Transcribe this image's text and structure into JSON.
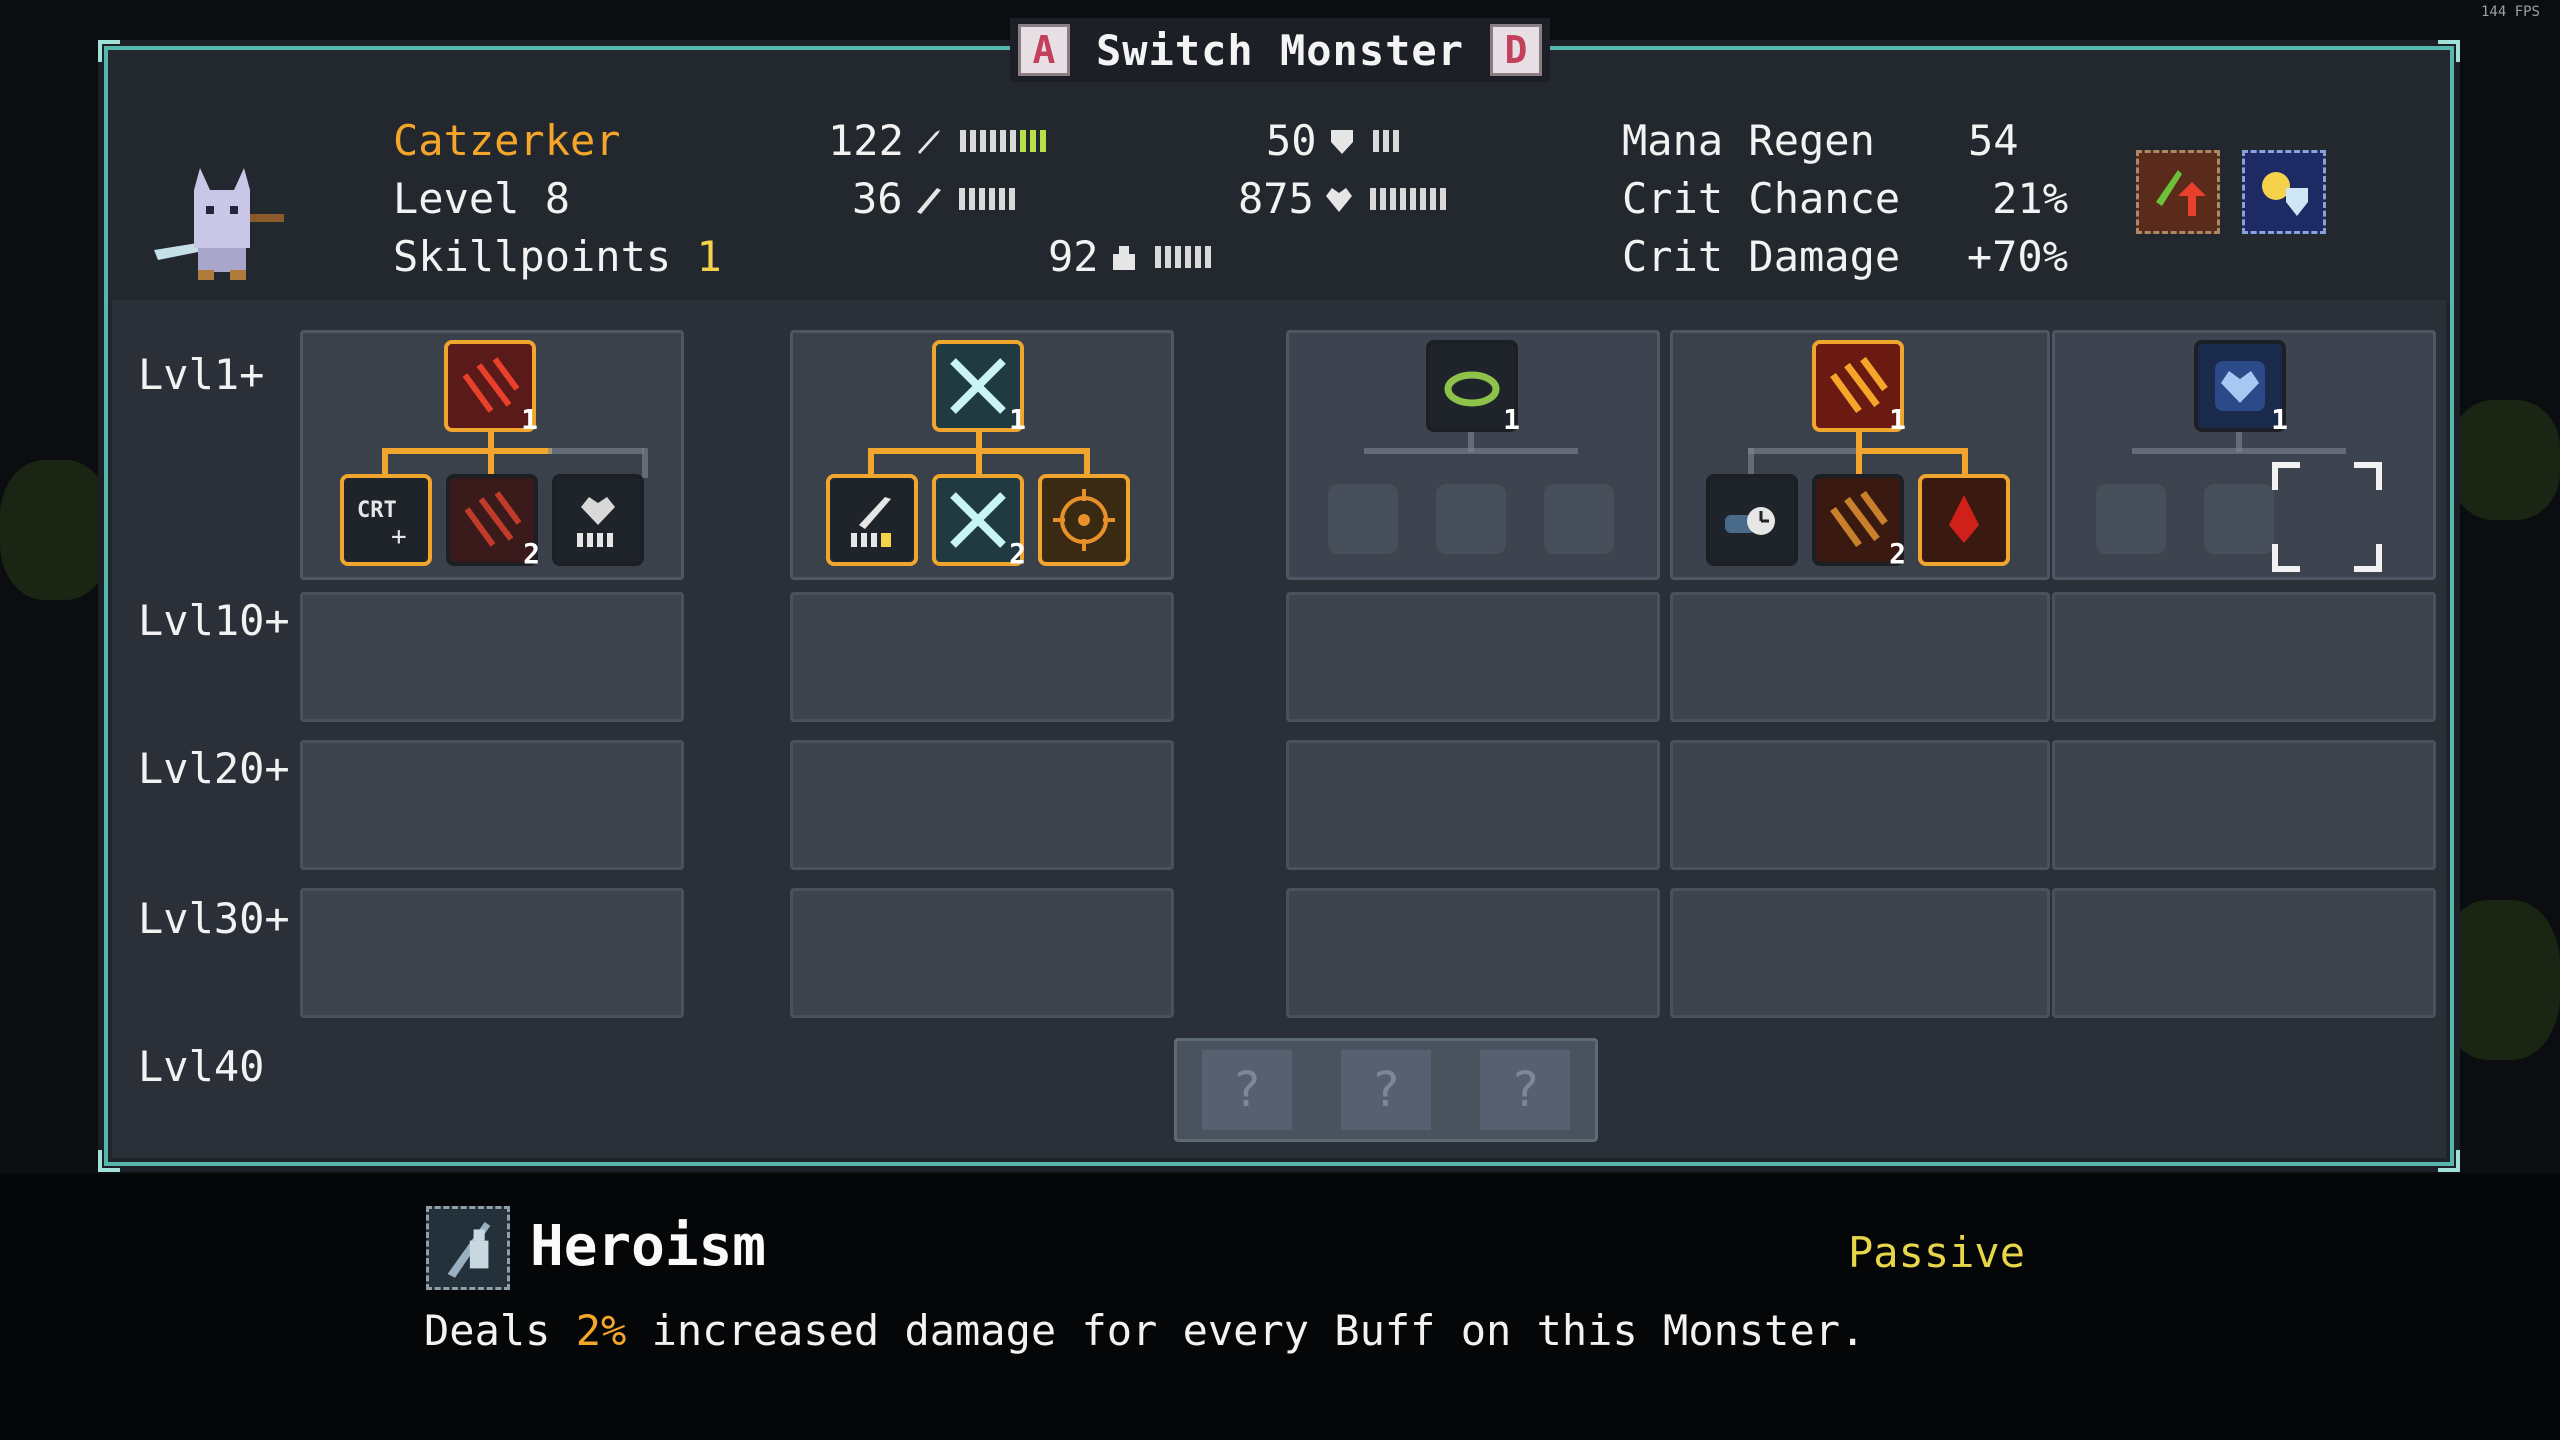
{
  "hud": {
    "fps": "144 FPS"
  },
  "title": {
    "key_left": "A",
    "text": "Switch Monster",
    "key_right": "D"
  },
  "monster": {
    "name": "Catzerker",
    "level": "Level 8",
    "skillpoints_label": "Skillpoints",
    "skillpoints_value": "1"
  },
  "stats": {
    "attack": "122",
    "magic": "36",
    "defense": "50",
    "health": "875",
    "mana": "92"
  },
  "right_stats": [
    {
      "label": "Mana Regen",
      "value": "54"
    },
    {
      "label": "Crit Chance",
      "value": "21%"
    },
    {
      "label": "Crit Damage",
      "value": "+70%"
    }
  ],
  "levels": [
    "Lvl1+",
    "Lvl10+",
    "Lvl20+",
    "Lvl30+",
    "Lvl40"
  ],
  "tree_columns": [
    {
      "root_icon": "claw-slash-icon",
      "root_count": "1",
      "children": [
        {
          "icon": "crit-icon",
          "count": ""
        },
        {
          "icon": "claw-slash-icon",
          "count": "2"
        },
        {
          "icon": "heart-bar-icon",
          "count": ""
        }
      ]
    },
    {
      "root_icon": "cross-blades-icon",
      "root_count": "1",
      "children": [
        {
          "icon": "sword-bar-icon",
          "count": ""
        },
        {
          "icon": "cross-blades-icon",
          "count": "2"
        },
        {
          "icon": "target-icon",
          "count": ""
        }
      ]
    },
    {
      "root_icon": "ring-icon",
      "root_count": "1",
      "children": []
    },
    {
      "root_icon": "fire-slash-icon",
      "root_count": "1",
      "children": [
        {
          "icon": "clock-icon",
          "count": ""
        },
        {
          "icon": "fire-slash-icon",
          "count": "2"
        },
        {
          "icon": "blood-drop-icon",
          "count": ""
        }
      ]
    },
    {
      "root_icon": "heart-shield-icon",
      "root_count": "1",
      "children": []
    }
  ],
  "lvl40": {
    "slots": [
      "?",
      "?",
      "?"
    ]
  },
  "tooltip": {
    "title": "Heroism",
    "type": "Passive",
    "desc_before": "Deals ",
    "desc_highlight": "2%",
    "desc_after": " increased damage for every Buff on this Monster."
  },
  "colors": {
    "accent": "#f0a52c",
    "frame": "#58b7ad",
    "name": "#f4a52a",
    "passive": "#e8d64a"
  }
}
